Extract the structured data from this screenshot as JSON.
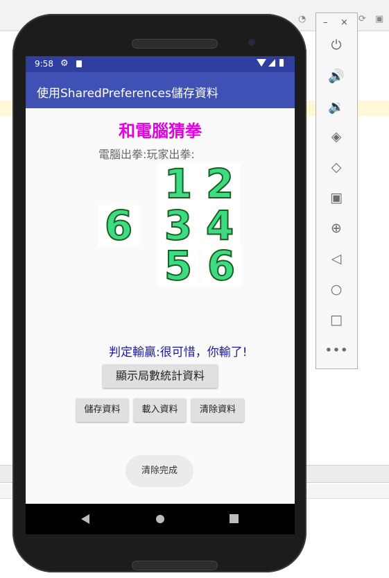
{
  "status": {
    "time": "9:58"
  },
  "app": {
    "title": "使用SharedPreferences儲存資料"
  },
  "game": {
    "heading": "和電腦猜拳",
    "labels": "電腦出拳:玩家出拳:",
    "computer_choice": "6",
    "player_options": [
      "1",
      "2",
      "3",
      "4",
      "5",
      "6"
    ],
    "result": "判定輸贏:很可惜，你輸了!"
  },
  "buttons": {
    "stats": "顯示局數統計資料",
    "save": "儲存資料",
    "load": "載入資料",
    "clear": "清除資料"
  },
  "toast": "清除完成",
  "toolbar": {
    "minimize": "–",
    "close": "×",
    "items": [
      "power-icon",
      "volume-up-icon",
      "volume-down-icon",
      "rotate-left-icon",
      "rotate-right-icon",
      "camera-icon",
      "zoom-in-icon",
      "back-icon",
      "home-icon",
      "overview-icon",
      "more-icon"
    ]
  },
  "colors": {
    "primary": "#3f51b5",
    "primary_dark": "#303f9f",
    "heading": "#e400e4",
    "result": "#1a1aa8",
    "digit": "#3ddc84"
  }
}
